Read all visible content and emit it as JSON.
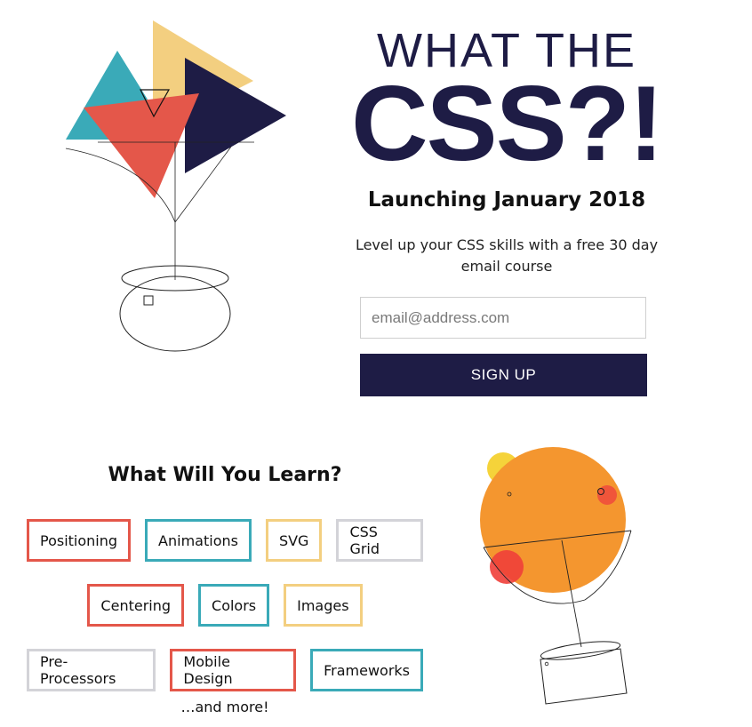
{
  "hero": {
    "title_line1": "WHAT THE",
    "title_line2": "CSS?!",
    "launch": "Launching January 2018",
    "blurb": "Level up your CSS skills with a free 30 day email course"
  },
  "signup": {
    "email_placeholder": "email@address.com",
    "button_label": "SIGN UP"
  },
  "learn": {
    "title": "What Will You Learn?",
    "rows": [
      [
        {
          "label": "Positioning",
          "color": "#e4574a"
        },
        {
          "label": "Animations",
          "color": "#3aaab8"
        },
        {
          "label": "SVG",
          "color": "#f3cf80"
        },
        {
          "label": "CSS Grid",
          "color": "#d3d3d8"
        }
      ],
      [
        {
          "label": "Centering",
          "color": "#e4574a"
        },
        {
          "label": "Colors",
          "color": "#3aaab8"
        },
        {
          "label": "Images",
          "color": "#f3cf80"
        }
      ],
      [
        {
          "label": "Pre-Processors",
          "color": "#d3d3d8"
        },
        {
          "label": "Mobile Design",
          "color": "#e4574a"
        },
        {
          "label": "Frameworks",
          "color": "#3aaab8"
        }
      ]
    ],
    "more": "…and more!"
  },
  "colors": {
    "navy": "#1e1c45",
    "red": "#e4574a",
    "teal": "#3aaab8",
    "yellow": "#f3cf80",
    "orange": "#f4962f"
  },
  "illustrations": [
    "triangle-balloon-illustration",
    "sphere-balloon-illustration"
  ]
}
